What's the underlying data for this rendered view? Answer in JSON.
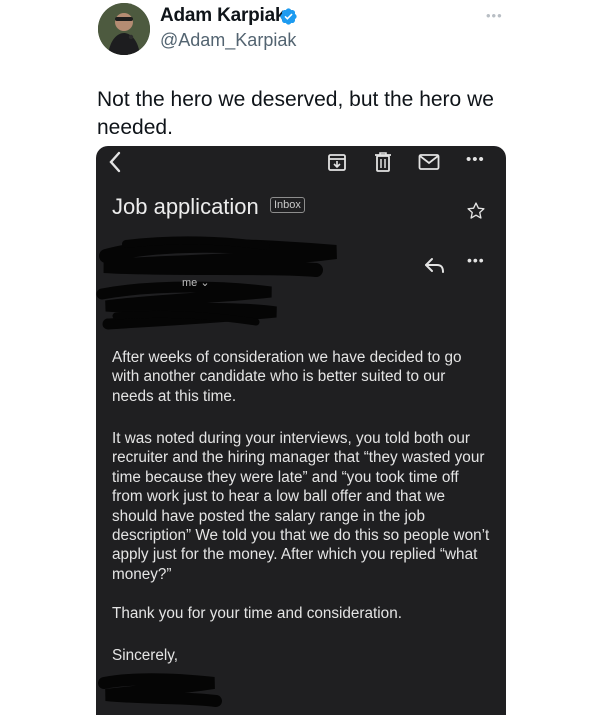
{
  "tweet": {
    "author_name": "Adam Karpiak",
    "author_handle": "@Adam_Karpiak",
    "text": "Not the hero we deserved, but the hero we needed."
  },
  "email": {
    "subject": "Job application",
    "label_chip": "Inbox",
    "recipient_label": "me ⌄",
    "paragraphs": [
      "After weeks of consideration we have decided to go with another candidate who is better suited to our needs at this time.",
      "It was noted during your interviews, you told both our recruiter and the hiring manager that “they wasted your time because they were late” and “you took time off from work just to hear a low ball offer and that we should have posted the salary range in the job description” We told you that we do this so people won’t apply just for the money. After which you replied “what money?”",
      "Thank you for your time and consideration.",
      "Sincerely,"
    ]
  },
  "colors": {
    "email_background": "#1f1f21",
    "verified_badge": "#1d9bf0",
    "handle_gray": "#536471"
  },
  "icons": [
    "verified-badge-icon",
    "more-horizontal-icon",
    "back-arrow-icon",
    "archive-icon",
    "trash-icon",
    "mail-icon",
    "star-icon",
    "reply-icon"
  ]
}
